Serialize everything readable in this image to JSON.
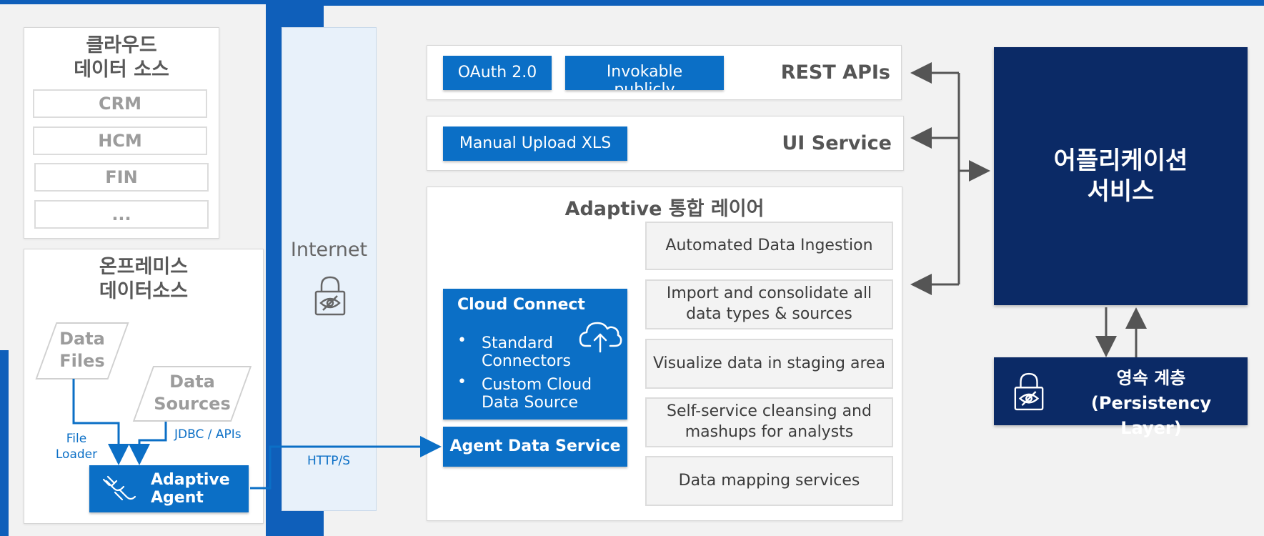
{
  "cloud_sources": {
    "title": "클라우드\n데이터 소스",
    "items": [
      "CRM",
      "HCM",
      "FIN",
      "..."
    ]
  },
  "onprem": {
    "title": "온프레미스\n데이터소스",
    "data_files": "Data\nFiles",
    "data_sources": "Data\nSources",
    "file_loader": "File\nLoader",
    "jdbc": "JDBC / APIs",
    "agent": "Adaptive\nAgent"
  },
  "internet": {
    "label": "Internet",
    "protocol": "HTTP/S"
  },
  "rest_apis": {
    "label": "REST APIs",
    "tags": [
      "OAuth 2.0",
      "Invokable\npublicly"
    ]
  },
  "ui_service": {
    "label": "UI Service",
    "tags": [
      "Manual Upload XLS"
    ]
  },
  "integration": {
    "title": "Adaptive 통합 레이어",
    "cloud_connect": {
      "title": "Cloud Connect",
      "bullets": [
        "Standard\nConnectors",
        "Custom Cloud\nData Source"
      ]
    },
    "agent_data_service": "Agent Data Service",
    "features": [
      "Automated Data Ingestion",
      "Import and consolidate all\ndata types & sources",
      "Visualize data in staging area",
      "Self-service cleansing and\nmashups for analysts",
      "Data mapping services"
    ]
  },
  "app_services": {
    "label": "어플리케이션\n서비스"
  },
  "persistency": {
    "label": "영속 계층\n(Persistency Layer)"
  },
  "colors": {
    "accent_blue": "#0b6fc6",
    "dark_navy": "#0b2a66",
    "header_blue": "#0f5fba"
  }
}
